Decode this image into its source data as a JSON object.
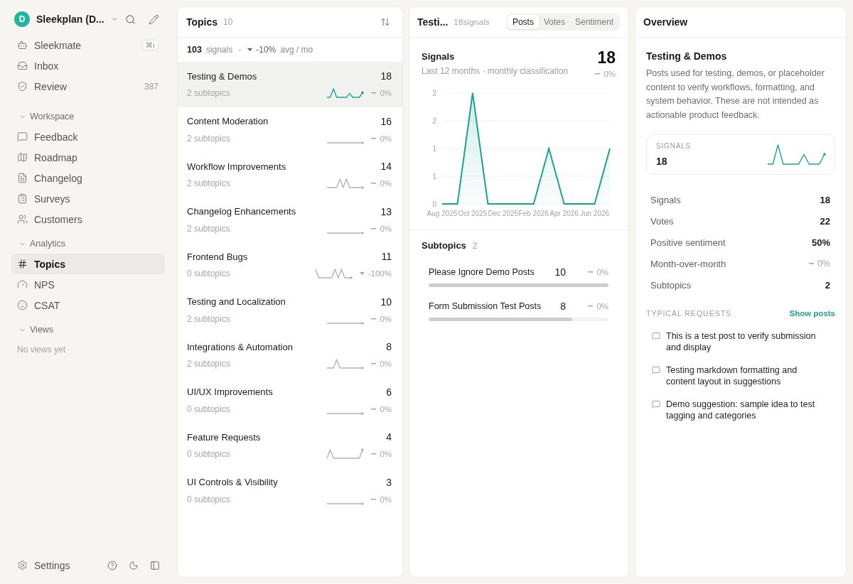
{
  "sidebar": {
    "workspace": {
      "avatar_letter": "D",
      "name": "Sleekplan (D..."
    },
    "top_items": [
      {
        "label": "Sleekmate",
        "shortcut": "⌘I",
        "selected": false
      },
      {
        "label": "Inbox",
        "selected": false
      },
      {
        "label": "Review",
        "count": "387",
        "selected": false
      }
    ],
    "sections": [
      {
        "title": "Workspace",
        "expanded": true,
        "items": [
          {
            "label": "Feedback",
            "selected": false
          },
          {
            "label": "Roadmap",
            "selected": false
          },
          {
            "label": "Changelog",
            "selected": false
          },
          {
            "label": "Surveys",
            "selected": false
          },
          {
            "label": "Customers",
            "selected": false
          }
        ]
      },
      {
        "title": "Analytics",
        "expanded": true,
        "items": [
          {
            "label": "Topics",
            "selected": true
          },
          {
            "label": "NPS",
            "selected": false
          },
          {
            "label": "CSAT",
            "selected": false
          }
        ]
      },
      {
        "title": "Views",
        "expanded": true,
        "empty_text": "No views yet"
      }
    ],
    "footer": {
      "settings_label": "Settings"
    }
  },
  "topics": {
    "title": "Topics",
    "count": "10",
    "summary": {
      "total": "103",
      "unit": "signals",
      "trend": {
        "kind": "down",
        "value": "-10%"
      },
      "period": "avg / mo"
    },
    "rows": [
      {
        "name": "Testing & Demos",
        "count": "18",
        "subtopics": "2 subtopics",
        "trend": {
          "kind": "flat",
          "value": "0%"
        },
        "selected": true
      },
      {
        "name": "Content Moderation",
        "count": "16",
        "subtopics": "2 subtopics",
        "trend": {
          "kind": "flat",
          "value": "0%"
        },
        "selected": false
      },
      {
        "name": "Workflow Improvements",
        "count": "14",
        "subtopics": "2 subtopics",
        "trend": {
          "kind": "flat",
          "value": "0%"
        },
        "selected": false
      },
      {
        "name": "Changelog Enhancements",
        "count": "13",
        "subtopics": "2 subtopics",
        "trend": {
          "kind": "flat",
          "value": "0%"
        },
        "selected": false
      },
      {
        "name": "Frontend Bugs",
        "count": "11",
        "subtopics": "0 subtopics",
        "trend": {
          "kind": "down",
          "value": "-100%"
        },
        "selected": false
      },
      {
        "name": "Testing and Localization",
        "count": "10",
        "subtopics": "2 subtopics",
        "trend": {
          "kind": "flat",
          "value": "0%"
        },
        "selected": false
      },
      {
        "name": "Integrations & Automation",
        "count": "8",
        "subtopics": "2 subtopics",
        "trend": {
          "kind": "flat",
          "value": "0%"
        },
        "selected": false
      },
      {
        "name": "UI/UX Improvements",
        "count": "6",
        "subtopics": "0 subtopics",
        "trend": {
          "kind": "flat",
          "value": "0%"
        },
        "selected": false
      },
      {
        "name": "Feature Requests",
        "count": "4",
        "subtopics": "0 subtopics",
        "trend": {
          "kind": "flat",
          "value": "0%"
        },
        "selected": false
      },
      {
        "name": "UI Controls & Visibility",
        "count": "3",
        "subtopics": "0 subtopics",
        "trend": {
          "kind": "flat",
          "value": "0%"
        },
        "selected": false
      }
    ]
  },
  "detail": {
    "title": "Testi...",
    "signal_count": "18signals",
    "tabs": [
      {
        "label": "Posts",
        "selected": true
      },
      {
        "label": "Votes",
        "selected": false
      },
      {
        "label": "Sentiment",
        "selected": false
      }
    ],
    "signals_chart": {
      "total": "18",
      "trend": {
        "kind": "flat",
        "value": "0%"
      },
      "chart_data": {
        "type": "area",
        "title": "Signals",
        "subtitle": "Last 12 months · monthly classification",
        "categories": [
          "Aug 2025",
          null,
          "Oct 2025",
          null,
          "Dec 2025",
          null,
          "Feb 2026",
          null,
          "Apr 2026",
          null,
          "Jun 2026",
          null
        ],
        "values": [
          0,
          0,
          2,
          0,
          0,
          0,
          0,
          1,
          0,
          0,
          0,
          1
        ],
        "color": "#1aa391",
        "ylim": [
          0,
          2
        ],
        "yticks": [
          {
            "value": 0,
            "label": "0"
          },
          {
            "value": 0.5,
            "label": "1"
          },
          {
            "value": 1,
            "label": "1"
          },
          {
            "value": 1.5,
            "label": "2"
          },
          {
            "value": 2,
            "label": "2"
          }
        ],
        "grid": true
      }
    },
    "subtopics": {
      "title": "Subtopics",
      "count": "2",
      "items": [
        {
          "name": "Please Ignore Demo Posts",
          "count": "10",
          "trend": {
            "kind": "flat",
            "value": "0%"
          },
          "level": 1
        },
        {
          "name": "Form Submission Test Posts",
          "count": "8",
          "trend": {
            "kind": "flat",
            "value": "0%"
          },
          "level": 0.8
        }
      ]
    }
  },
  "overview": {
    "title": "Overview",
    "topic": "Testing & Demos",
    "description": "Posts used for testing, demos, or placeholder content to verify workflows, formatting, and system behavior. These are not intended as actionable product feedback.",
    "card": {
      "label": "SIGNALS",
      "value": "18"
    },
    "stats": [
      {
        "kind": "number",
        "label": "Signals",
        "value": "18"
      },
      {
        "kind": "number",
        "label": "Votes",
        "value": "22"
      },
      {
        "kind": "number",
        "label": "Positive sentiment",
        "value": "50%"
      },
      {
        "kind": "trend",
        "label": "Month-over-month",
        "trend": {
          "kind": "flat",
          "value": "0%"
        }
      },
      {
        "kind": "number",
        "label": "Subtopics",
        "value": "2"
      }
    ],
    "requests_title": "TYPICAL REQUESTS",
    "show_posts": "Show posts",
    "requests": [
      "This is a test post to verify submission and display",
      "Testing markdown formatting and content layout in suggestions",
      "Demo suggestion: sample idea to test tagging and categories"
    ]
  }
}
